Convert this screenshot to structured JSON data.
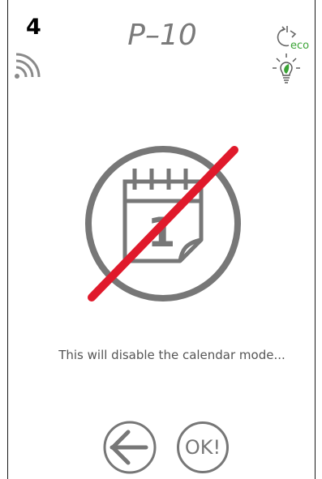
{
  "header": {
    "zone_number": "4",
    "program_title": "P–10",
    "eco_label": "eco"
  },
  "icons": {
    "wifi": "wifi-signal-icon",
    "eco": "eco-cycle-icon",
    "bulb": "leaf-bulb-icon",
    "main": "calendar-disabled-icon",
    "back": "arrow-left-icon"
  },
  "main": {
    "calendar_day": "1",
    "message": "This will disable the calendar mode..."
  },
  "buttons": {
    "ok_label": "OK!"
  },
  "colors": {
    "title_gray": "#7a7a7a",
    "icon_gray": "#777777",
    "strike_red": "#e0192b",
    "eco_green": "#3aa335"
  }
}
